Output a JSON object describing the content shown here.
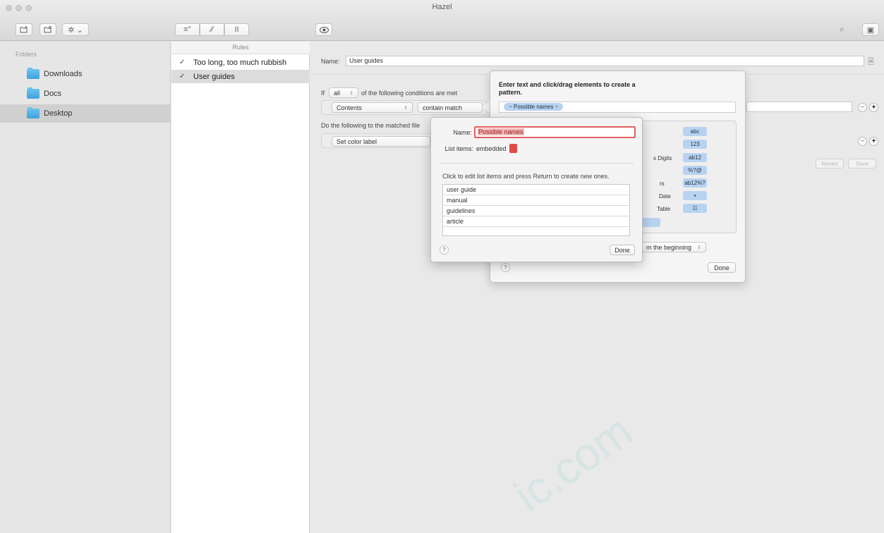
{
  "window": {
    "title": "Hazel"
  },
  "toolbar": {
    "left_icons": [
      "new-folder-icon",
      "folder-settings-icon",
      "gear-menu-icon"
    ],
    "rule_icons": [
      "add-rule-icon",
      "activity-icon",
      "pause-icon"
    ],
    "preview_icon": "eye-icon",
    "right_icons": [
      "search-icon",
      "trash-icon"
    ]
  },
  "sidebar": {
    "header": "Folders",
    "items": [
      {
        "label": "Downloads",
        "selected": false
      },
      {
        "label": "Docs",
        "selected": false
      },
      {
        "label": "Desktop",
        "selected": true
      }
    ]
  },
  "rules": {
    "header": "Rules",
    "items": [
      {
        "label": "Too long, too much rubbish",
        "checked": true,
        "selected": false
      },
      {
        "label": "User guides",
        "checked": true,
        "selected": true
      }
    ]
  },
  "editor": {
    "name_label": "Name:",
    "name_value": "User guides",
    "if_label": "If",
    "match_value": "all",
    "conditions_text": "of the following conditions are met",
    "condition": {
      "attribute": "Contents",
      "operator": "contain match"
    },
    "do_text": "Do the following to the matched file",
    "action": {
      "value": "Set color label"
    },
    "revert_label": "Revert",
    "save_label": "Save"
  },
  "pattern_popover": {
    "title": "Enter text and click/drag elements to create a pattern.",
    "token": "~ Possible names ~",
    "token_rows": [
      {
        "label": "",
        "chip": "abc"
      },
      {
        "label": "",
        "chip": "123"
      },
      {
        "label": "s Digits",
        "chip": "ab12"
      },
      {
        "label": "",
        "chip": "%?@"
      },
      {
        "label": "rs",
        "chip": "ab12%?"
      },
      {
        "label": "Date",
        "chip": "▪"
      },
      {
        "label": "Table",
        "chip": "☷"
      }
    ],
    "match_from": "m the beginning",
    "help": "?",
    "done_label": "Done"
  },
  "names_sheet": {
    "name_label": "Name:",
    "name_value": "Possible names",
    "list_items_label": "List items:",
    "list_items_value": "embedded",
    "instructions": "Click to edit list items and press Return to create new ones.",
    "items": [
      "user guide",
      "manual",
      "guidelines",
      "article",
      ""
    ],
    "help": "?",
    "done_label": "Done"
  },
  "watermark": "ic.com"
}
